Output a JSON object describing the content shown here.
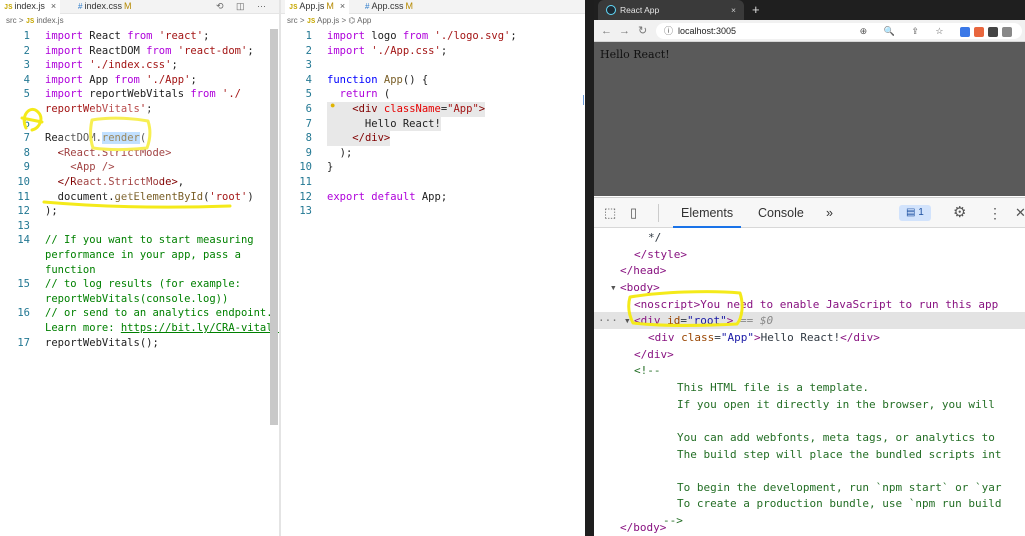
{
  "left_editor": {
    "tabs": [
      {
        "badge": "JS",
        "label": "index.js",
        "close": "×",
        "active": true
      },
      {
        "badge": "#",
        "label": "index.css",
        "modified": "M",
        "active": false
      }
    ],
    "tab_tools": "⟲ ◫ ⋯",
    "breadcrumb": {
      "folder": "src",
      "sep": ">",
      "badge": "JS",
      "file": "index.js"
    },
    "lines": [
      {
        "n": "1",
        "code": "import React from 'react';"
      },
      {
        "n": "2",
        "code": "import ReactDOM from 'react-dom';"
      },
      {
        "n": "3",
        "code": "import './index.css';"
      },
      {
        "n": "4",
        "code": "import App from './App';"
      },
      {
        "n": "5",
        "code": "import reportWebVitals from './"
      },
      {
        "n": "",
        "code": "reportWebVitals';"
      },
      {
        "n": "6",
        "code": ""
      },
      {
        "n": "7",
        "code": "ReactDOM.render("
      },
      {
        "n": "8",
        "code": "  <React.StrictMode>"
      },
      {
        "n": "9",
        "code": "    <App />"
      },
      {
        "n": "10",
        "code": "  </React.StrictMode>,"
      },
      {
        "n": "11",
        "code": "  document.getElementById('root')"
      },
      {
        "n": "12",
        "code": ");"
      },
      {
        "n": "13",
        "code": ""
      },
      {
        "n": "14",
        "code": "// If you want to start measuring"
      },
      {
        "n": "",
        "code": "performance in your app, pass a"
      },
      {
        "n": "",
        "code": "function"
      },
      {
        "n": "15",
        "code": "// to log results (for example:"
      },
      {
        "n": "",
        "code": "reportWebVitals(console.log))"
      },
      {
        "n": "16",
        "code": "// or send to an analytics endpoint."
      },
      {
        "n": "",
        "code": "Learn more: https://bit.ly/CRA-vitals"
      },
      {
        "n": "17",
        "code": "reportWebVitals();"
      }
    ]
  },
  "mid_editor": {
    "tabs": [
      {
        "badge": "JS",
        "label": "App.js",
        "modified": "M",
        "close": "×",
        "active": true
      },
      {
        "badge": "#",
        "label": "App.css",
        "modified": "M",
        "active": false
      }
    ],
    "breadcrumb": {
      "folder": "src",
      "sep": ">",
      "badge": "JS",
      "file": "App.js",
      "symbol_icon": "⌬",
      "symbol": "App"
    },
    "lines": [
      {
        "n": "1",
        "code": "import logo from './logo.svg';"
      },
      {
        "n": "2",
        "code": "import './App.css';"
      },
      {
        "n": "3",
        "code": ""
      },
      {
        "n": "4",
        "code": "function App() {"
      },
      {
        "n": "5",
        "code": "  return ("
      },
      {
        "n": "6",
        "code": "    <div className=\"App\">"
      },
      {
        "n": "7",
        "code": "      Hello React!"
      },
      {
        "n": "8",
        "code": "    </div>"
      },
      {
        "n": "9",
        "code": "  );"
      },
      {
        "n": "10",
        "code": "}"
      },
      {
        "n": "11",
        "code": ""
      },
      {
        "n": "12",
        "code": "export default App;"
      },
      {
        "n": "13",
        "code": ""
      }
    ]
  },
  "browser": {
    "tab_title": "React App",
    "tab_close": "×",
    "new_tab": "+",
    "nav": {
      "back": "←",
      "forward": "→",
      "reload": "↻"
    },
    "url": "localhost:3005",
    "info_icon": "ⓘ",
    "page_text": "Hello React!",
    "omnibox_icons": "⊕ 🔍 ⇪ ☆"
  },
  "devtools": {
    "tabs": [
      "Elements",
      "Console",
      "»"
    ],
    "issues_count": "1",
    "lines": [
      "*/",
      "</style>",
      "</head>",
      "<body>",
      "<noscript>You need to enable JavaScript to run this app",
      "<div id=\"root\"> == $0",
      "<div class=\"App\">Hello React!</div>",
      "</div>",
      "<!--",
      "This HTML file is a template.",
      "If you open it directly in the browser, you will",
      "",
      "You can add webfonts, meta tags, or analytics to",
      "The build step will place the bundled scripts int",
      "",
      "To begin the development, run `npm start` or `yar",
      "To create a production bundle, use `npm run build",
      "-->",
      "</body>"
    ],
    "gutter_dots": "···"
  },
  "colors": {
    "annotation": "#f4ea1a",
    "selection": "#add6ff",
    "devtools_accent": "#1a73e8"
  }
}
